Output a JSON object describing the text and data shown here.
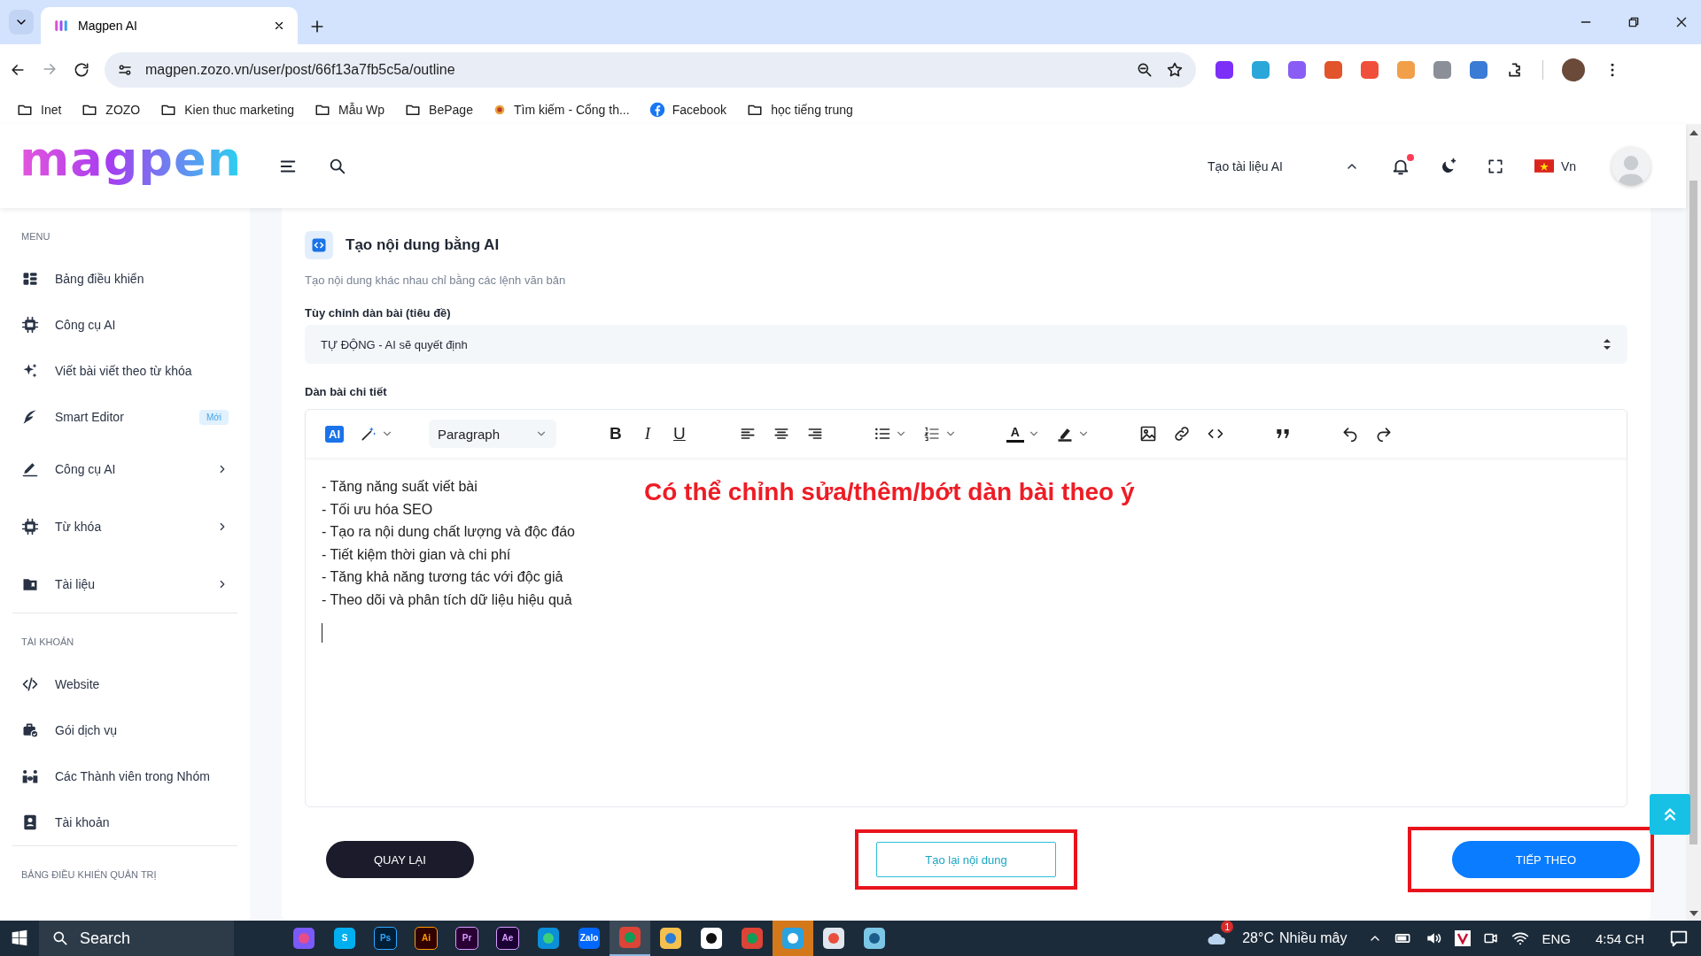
{
  "browser": {
    "tabs": [
      {
        "title": "Magpen AI",
        "selected": true
      }
    ],
    "url": "magpen.zozo.vn/user/post/66f13a7fb5c5a/outline",
    "bookmarks": [
      {
        "label": "Inet",
        "kind": "folder"
      },
      {
        "label": "ZOZO",
        "kind": "folder"
      },
      {
        "label": "Kien thuc marketing",
        "kind": "folder"
      },
      {
        "label": "Mẫu Wp",
        "kind": "folder"
      },
      {
        "label": "BePage",
        "kind": "folder"
      },
      {
        "label": "Tìm kiếm - Cổng th...",
        "kind": "site"
      },
      {
        "label": "Facebook",
        "kind": "facebook"
      },
      {
        "label": "học tiếng trung",
        "kind": "folder"
      }
    ]
  },
  "header": {
    "logo": "magpen",
    "doc_menu": "Tạo tài liệu AI",
    "notification_dot": true,
    "language": "Vn"
  },
  "sidebar": {
    "sections": [
      {
        "title": "MENU",
        "items": [
          {
            "label": "Bảng điều khiển",
            "expandable": false
          },
          {
            "label": "Công cụ AI",
            "expandable": false
          },
          {
            "label": "Viết bài viết theo từ khóa",
            "expandable": false
          },
          {
            "label": "Smart Editor",
            "badge": "Mới",
            "expandable": false
          },
          {
            "label": "Công cụ AI",
            "expandable": true
          },
          {
            "label": "Từ khóa",
            "expandable": true
          },
          {
            "label": "Tài liệu",
            "expandable": true
          }
        ]
      },
      {
        "title": "TÀI KHOẢN",
        "items": [
          {
            "label": "Website",
            "expandable": false
          },
          {
            "label": "Gói dịch vụ",
            "expandable": false
          },
          {
            "label": "Các Thành viên trong Nhóm",
            "expandable": false
          },
          {
            "label": "Tài khoản",
            "expandable": false
          }
        ]
      },
      {
        "title": "BẢNG ĐIỀU KHIỂN QUẢN TRỊ"
      }
    ]
  },
  "card": {
    "title": "Tạo nội dung bằng AI",
    "subtitle": "Tạo nội dung khác nhau chỉ bằng các lệnh văn bản",
    "outline_field": {
      "label": "Tùy chỉnh dàn bài (tiêu đề)",
      "value": "TỰ ĐỘNG - AI sẽ quyết định"
    },
    "editor": {
      "label": "Dàn bài chi tiết",
      "toolbar": {
        "ai_label": "AI",
        "block_style": "Paragraph",
        "format_marks": [
          "B",
          "I",
          "U"
        ],
        "color_mark": "A"
      },
      "content": [
        "- Tăng năng suất viết bài",
        "- Tối ưu hóa SEO",
        "- Tạo ra nội dung chất lượng và độc đáo",
        "- Tiết kiệm thời gian và chi phí",
        "- Tăng khả năng tương tác với độc giả",
        "- Theo dõi và phân tích dữ liệu hiệu quả"
      ],
      "annotation": "Có thể chỉnh sửa/thêm/bớt dàn bài theo ý"
    },
    "actions": [
      {
        "label": "QUAY LẠI",
        "kind": "dark",
        "highlighted": false
      },
      {
        "label": "Tạo lại nội dung",
        "kind": "outline",
        "highlighted": true
      },
      {
        "label": "TIẾP THEO",
        "kind": "primary",
        "highlighted": true
      }
    ]
  },
  "taskbar": {
    "search": "Search",
    "apps": [
      {
        "kind": "copilot",
        "selected": false,
        "flashing": false
      },
      {
        "kind": "skype",
        "label": "S",
        "selected": false,
        "flashing": false
      },
      {
        "kind": "photoshop",
        "label": "Ps",
        "selected": false,
        "flashing": false
      },
      {
        "kind": "illustrator",
        "label": "Ai",
        "selected": false,
        "flashing": false
      },
      {
        "kind": "premiere",
        "label": "Pr",
        "selected": false,
        "flashing": false
      },
      {
        "kind": "aftereffects",
        "label": "Ae",
        "selected": false,
        "flashing": false
      },
      {
        "kind": "edge",
        "selected": false,
        "flashing": false
      },
      {
        "kind": "zalo",
        "label": "Zalo",
        "selected": false,
        "flashing": false
      },
      {
        "kind": "chrome",
        "selected": true,
        "flashing": false
      },
      {
        "kind": "files",
        "selected": false,
        "flashing": false
      },
      {
        "kind": "capcut",
        "selected": false,
        "flashing": false
      },
      {
        "kind": "chrome",
        "selected": false,
        "flashing": false
      },
      {
        "kind": "telegram",
        "selected": false,
        "flashing": true
      },
      {
        "kind": "paint",
        "selected": false,
        "flashing": false
      },
      {
        "kind": "notepad",
        "selected": false,
        "flashing": false
      }
    ],
    "weather": {
      "temp": "28°C",
      "condition": "Nhiều mây",
      "badge": "1"
    },
    "language": "ENG",
    "clock": "4:54 CH"
  }
}
